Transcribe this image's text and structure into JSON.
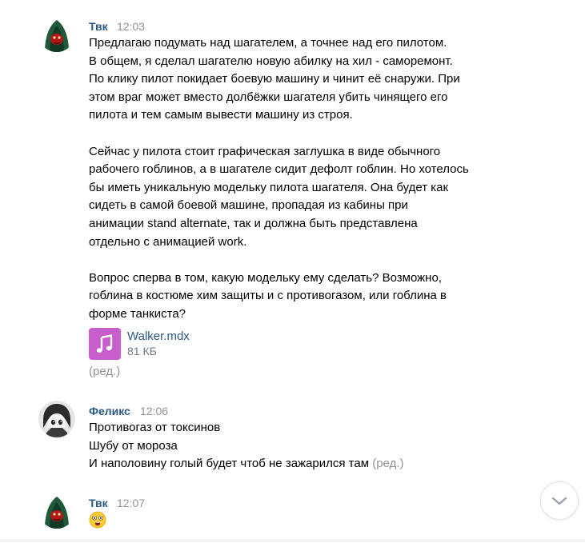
{
  "messages": [
    {
      "author": "Твк",
      "time": "12:03",
      "lines": [
        "Предлагаю подумать над шагателем, а точнее над его пилотом.",
        "В общем, я сделал шагателю новую абилку на хил - саморемонт.",
        "По клику пилот покидает боевую машину и чинит её снаружи. При",
        "этом враг может вместо долбёжки шагателя убить чинящего его",
        "пилота и тем самым вывести машину из строя.",
        "",
        "Сейчас у пилота стоит графическая заглушка в виде обычного",
        "рабочего гоблинов, а в шагателе сидит дефолт гоблин. Но хотелось",
        "бы иметь уникальную модельку пилота шагателя. Она будет как",
        "сидеть в самой боевой машине, пропадая из кабины при",
        "анимации stand alternate, так и должна быть представлена",
        "отдельно с анимацией work.",
        "",
        "Вопрос сперва в том, какую модельку ему сделать? Возможно,",
        "гоблина в костюме хим защиты и с противогазом, или гоблина в",
        "форме танкиста?"
      ],
      "attachment": {
        "name": "Walker.mdx",
        "size": "81 КБ",
        "icon": "music-note-icon"
      },
      "edited": "(ред.)"
    },
    {
      "author": "Феликс",
      "time": "12:06",
      "lines": [
        "Противогаз от токсинов",
        "Шубу от мороза",
        "И наполовину голый будет чтоб не зажарился там"
      ],
      "edited": "(ред.)"
    },
    {
      "author": "Твк",
      "time": "12:07",
      "emoji": "astonished-face-emoji"
    }
  ],
  "scroll_button": {
    "icon": "chevron-down-icon"
  },
  "colors": {
    "link": "#2a5885",
    "meta": "#939393",
    "file_icon": "#c85ecb"
  }
}
